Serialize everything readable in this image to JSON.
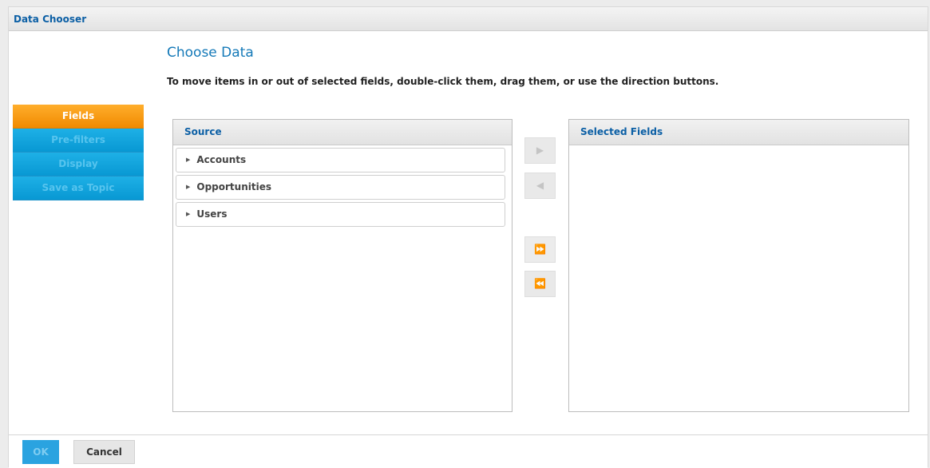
{
  "dialog": {
    "title": "Data Chooser"
  },
  "heading": "Choose Data",
  "instructions": "To move items in or out of selected fields, double-click them, drag them, or use the direction buttons.",
  "nav": {
    "items": [
      {
        "label": "Fields",
        "state": "active"
      },
      {
        "label": "Pre-filters",
        "state": "disabled"
      },
      {
        "label": "Display",
        "state": "disabled"
      },
      {
        "label": "Save as Topic",
        "state": "disabled"
      }
    ]
  },
  "source": {
    "header": "Source",
    "items": [
      {
        "label": "Accounts",
        "icon": "expand-triangle-icon"
      },
      {
        "label": "Opportunities",
        "icon": "expand-triangle-icon"
      },
      {
        "label": "Users",
        "icon": "expand-triangle-icon"
      }
    ]
  },
  "selected": {
    "header": "Selected Fields",
    "items": []
  },
  "move_buttons": {
    "add": {
      "glyph": "▶",
      "enabled": false
    },
    "remove": {
      "glyph": "◀",
      "enabled": false
    },
    "add_all": {
      "glyph": "⏩",
      "enabled": true
    },
    "remove_all": {
      "glyph": "⏪",
      "enabled": false
    }
  },
  "footer": {
    "ok_label": "OK",
    "cancel_label": "Cancel"
  },
  "colors": {
    "accent_blue": "#1479b8",
    "nav_active": "#f18a00",
    "nav_inactive": "#0898d3",
    "ok_button": "#2aa3e0"
  }
}
